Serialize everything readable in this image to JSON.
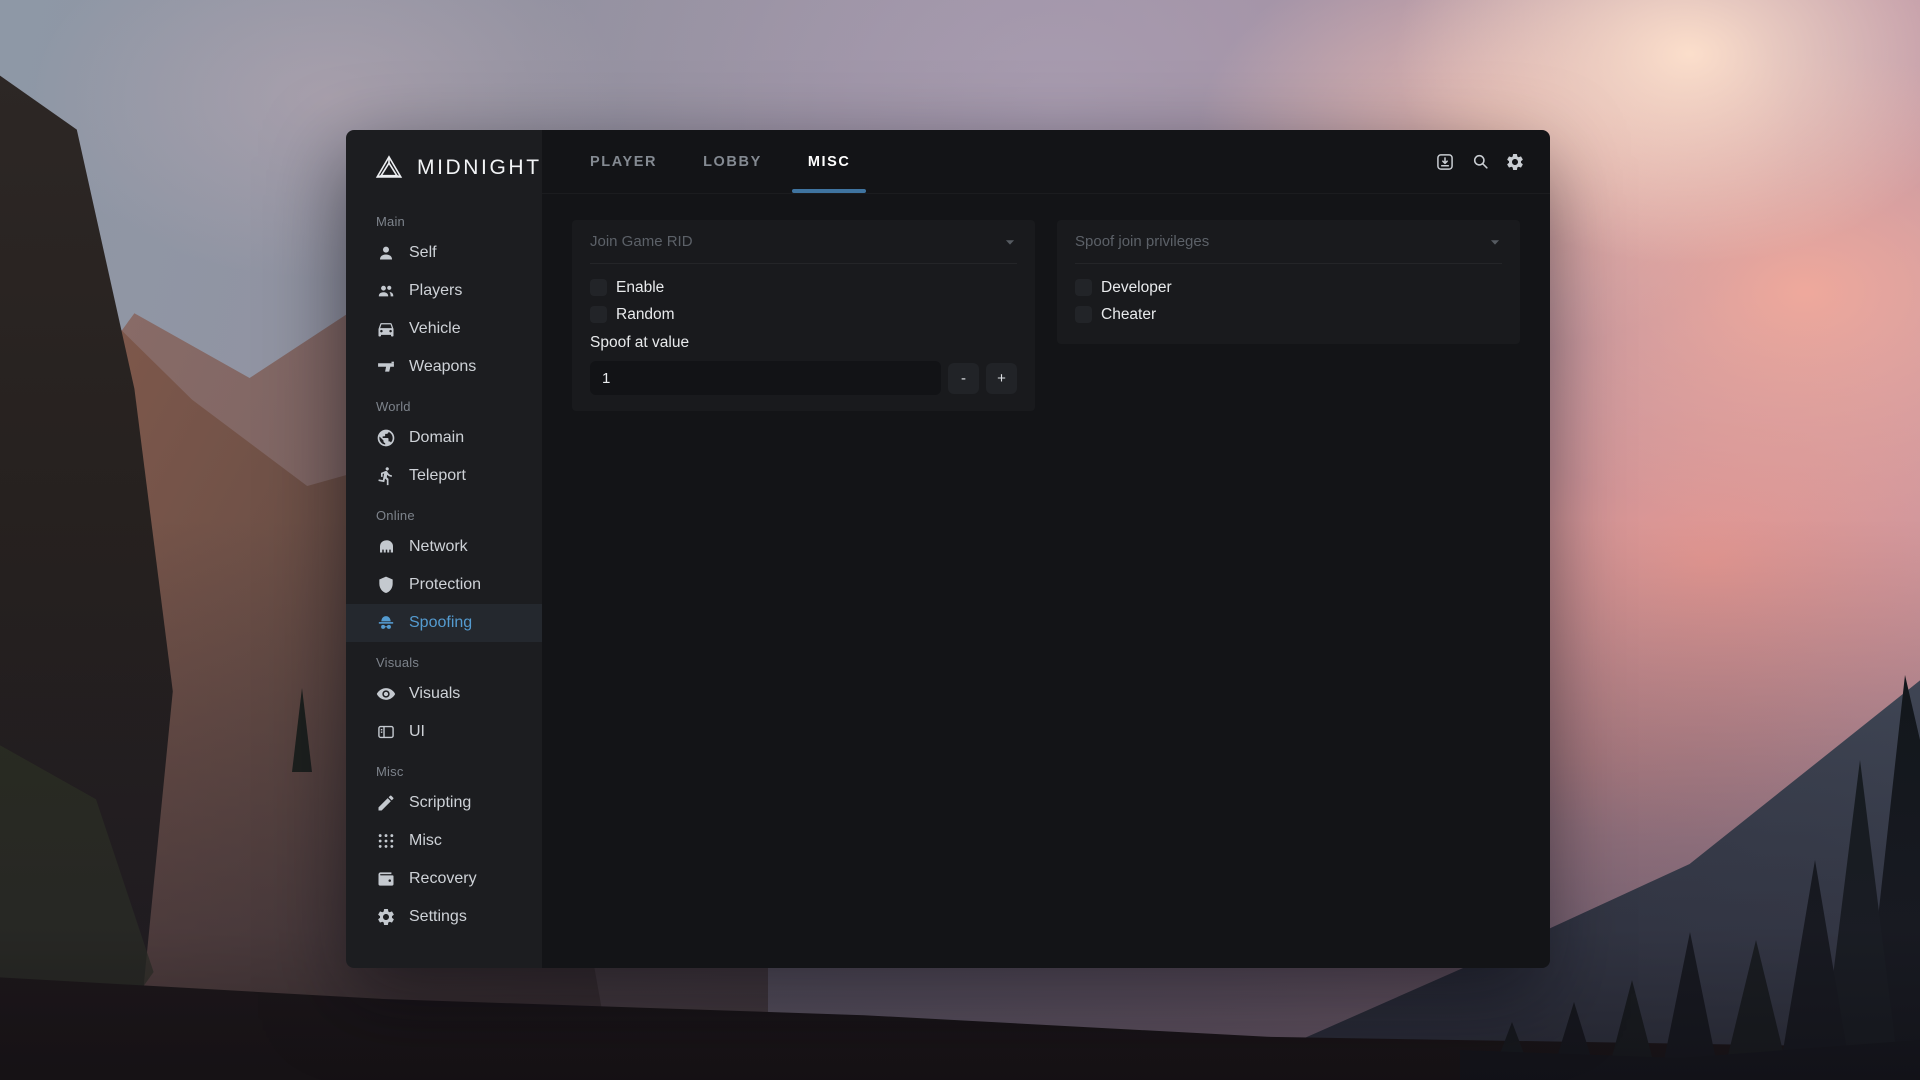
{
  "theme": {
    "accent": "#549bd0",
    "accent_underline": "#3f74a0",
    "sidebar_bg": "#1c1d20",
    "content_bg": "#131417",
    "card_bg": "#191a1d"
  },
  "window": {
    "brand": "MIDNIGHT",
    "tabs": [
      {
        "label": "PLAYER",
        "active": false
      },
      {
        "label": "LOBBY",
        "active": false
      },
      {
        "label": "MISC",
        "active": true
      }
    ],
    "toolbar": [
      {
        "icon": "save-icon"
      },
      {
        "icon": "search-icon"
      },
      {
        "icon": "settings-icon"
      }
    ],
    "sidebar": {
      "groups": [
        {
          "label": "Main",
          "items": [
            {
              "label": "Self",
              "icon": "person-icon",
              "active": false
            },
            {
              "label": "Players",
              "icon": "people-icon",
              "active": false
            },
            {
              "label": "Vehicle",
              "icon": "car-icon",
              "active": false
            },
            {
              "label": "Weapons",
              "icon": "pistol-icon",
              "active": false
            }
          ]
        },
        {
          "label": "World",
          "items": [
            {
              "label": "Domain",
              "icon": "globe-icon",
              "active": false
            },
            {
              "label": "Teleport",
              "icon": "running-person-icon",
              "active": false
            }
          ]
        },
        {
          "label": "Online",
          "items": [
            {
              "label": "Network",
              "icon": "network-icon",
              "active": false
            },
            {
              "label": "Protection",
              "icon": "shield-icon",
              "active": false
            },
            {
              "label": "Spoofing",
              "icon": "incognito-icon",
              "active": true
            }
          ]
        },
        {
          "label": "Visuals",
          "items": [
            {
              "label": "Visuals",
              "icon": "eye-icon",
              "active": false
            },
            {
              "label": "UI",
              "icon": "layout-icon",
              "active": false
            }
          ]
        },
        {
          "label": "Misc",
          "items": [
            {
              "label": "Scripting",
              "icon": "pencil-icon",
              "active": false
            },
            {
              "label": "Misc",
              "icon": "grid-dots-icon",
              "active": false
            },
            {
              "label": "Recovery",
              "icon": "wallet-icon",
              "active": false
            },
            {
              "label": "Settings",
              "icon": "gear-icon",
              "active": false
            }
          ]
        }
      ]
    },
    "sections": [
      {
        "title": "Join Game RID",
        "checkboxes": [
          {
            "label": "Enable",
            "checked": false
          },
          {
            "label": "Random",
            "checked": false
          }
        ],
        "field_label": "Spoof at value",
        "field_value": "1",
        "decrement_label": "-",
        "increment_label": "+"
      },
      {
        "title": "Spoof join privileges",
        "checkboxes": [
          {
            "label": "Developer",
            "checked": false
          },
          {
            "label": "Cheater",
            "checked": false
          }
        ]
      }
    ]
  }
}
